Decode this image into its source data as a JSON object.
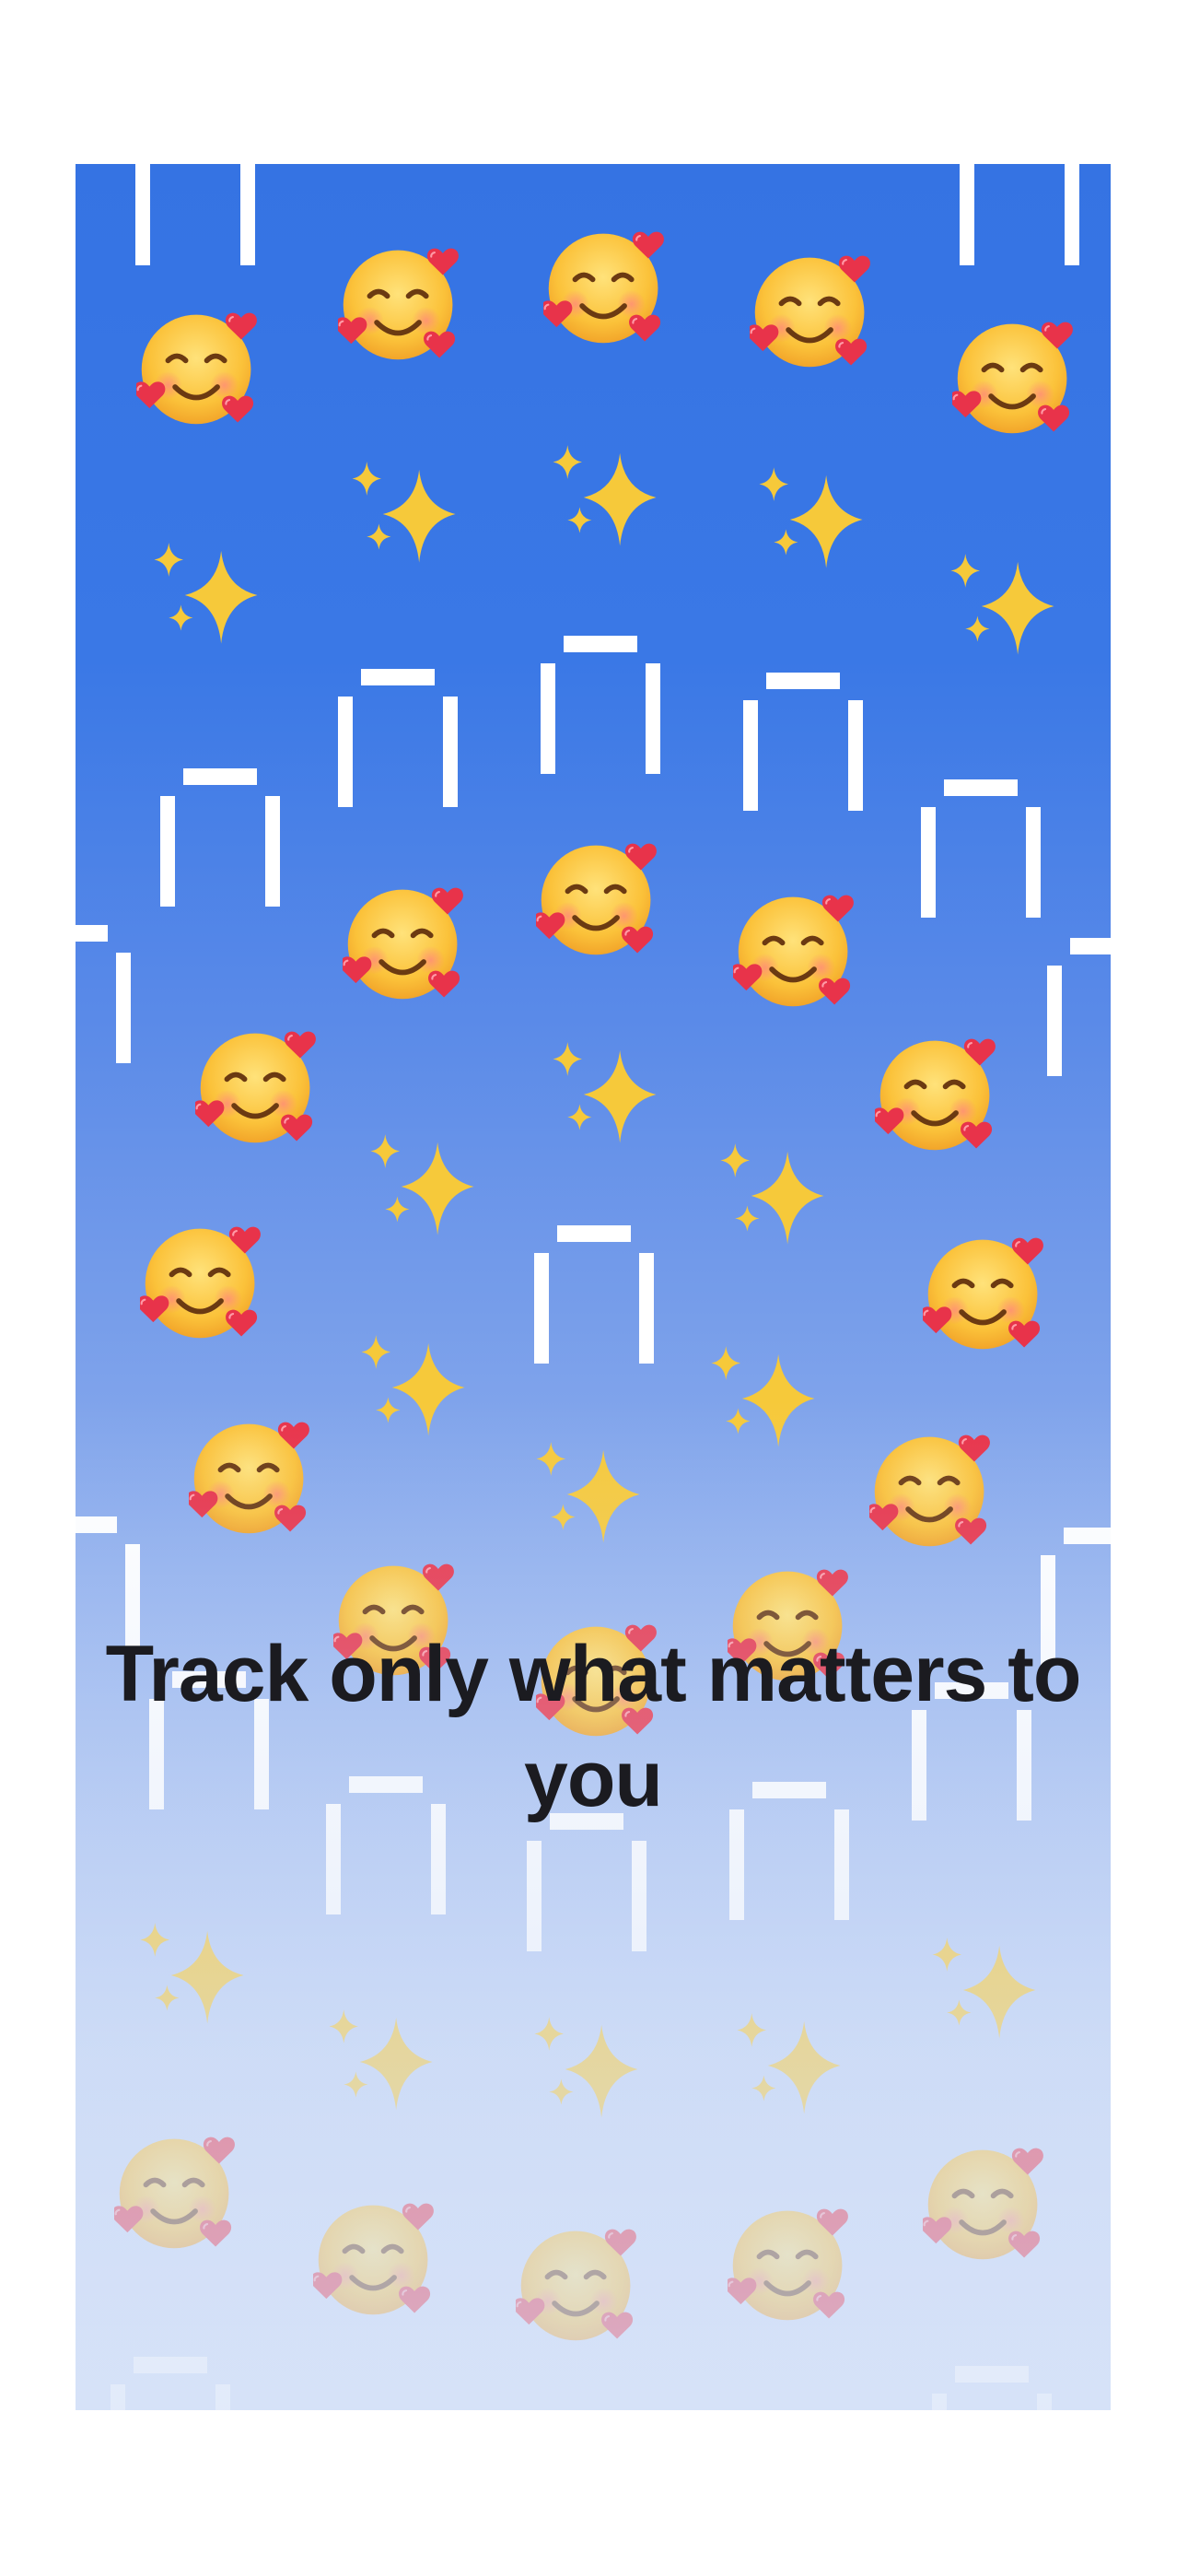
{
  "onboarding": {
    "headline": "Track only what matters to you"
  },
  "background": {
    "gradient_top": "#3573e3",
    "gradient_bottom": "#d6e2f8",
    "pattern_icons": [
      "smiling-face-with-hearts-icon",
      "sparkles-icon",
      "bracket-shape-icon"
    ]
  },
  "colors": {
    "page": "#ffffff",
    "headline": "#1b1b20",
    "sparkle": "#f6c93a",
    "face": "#f7b733",
    "heart": "#e8334a"
  }
}
